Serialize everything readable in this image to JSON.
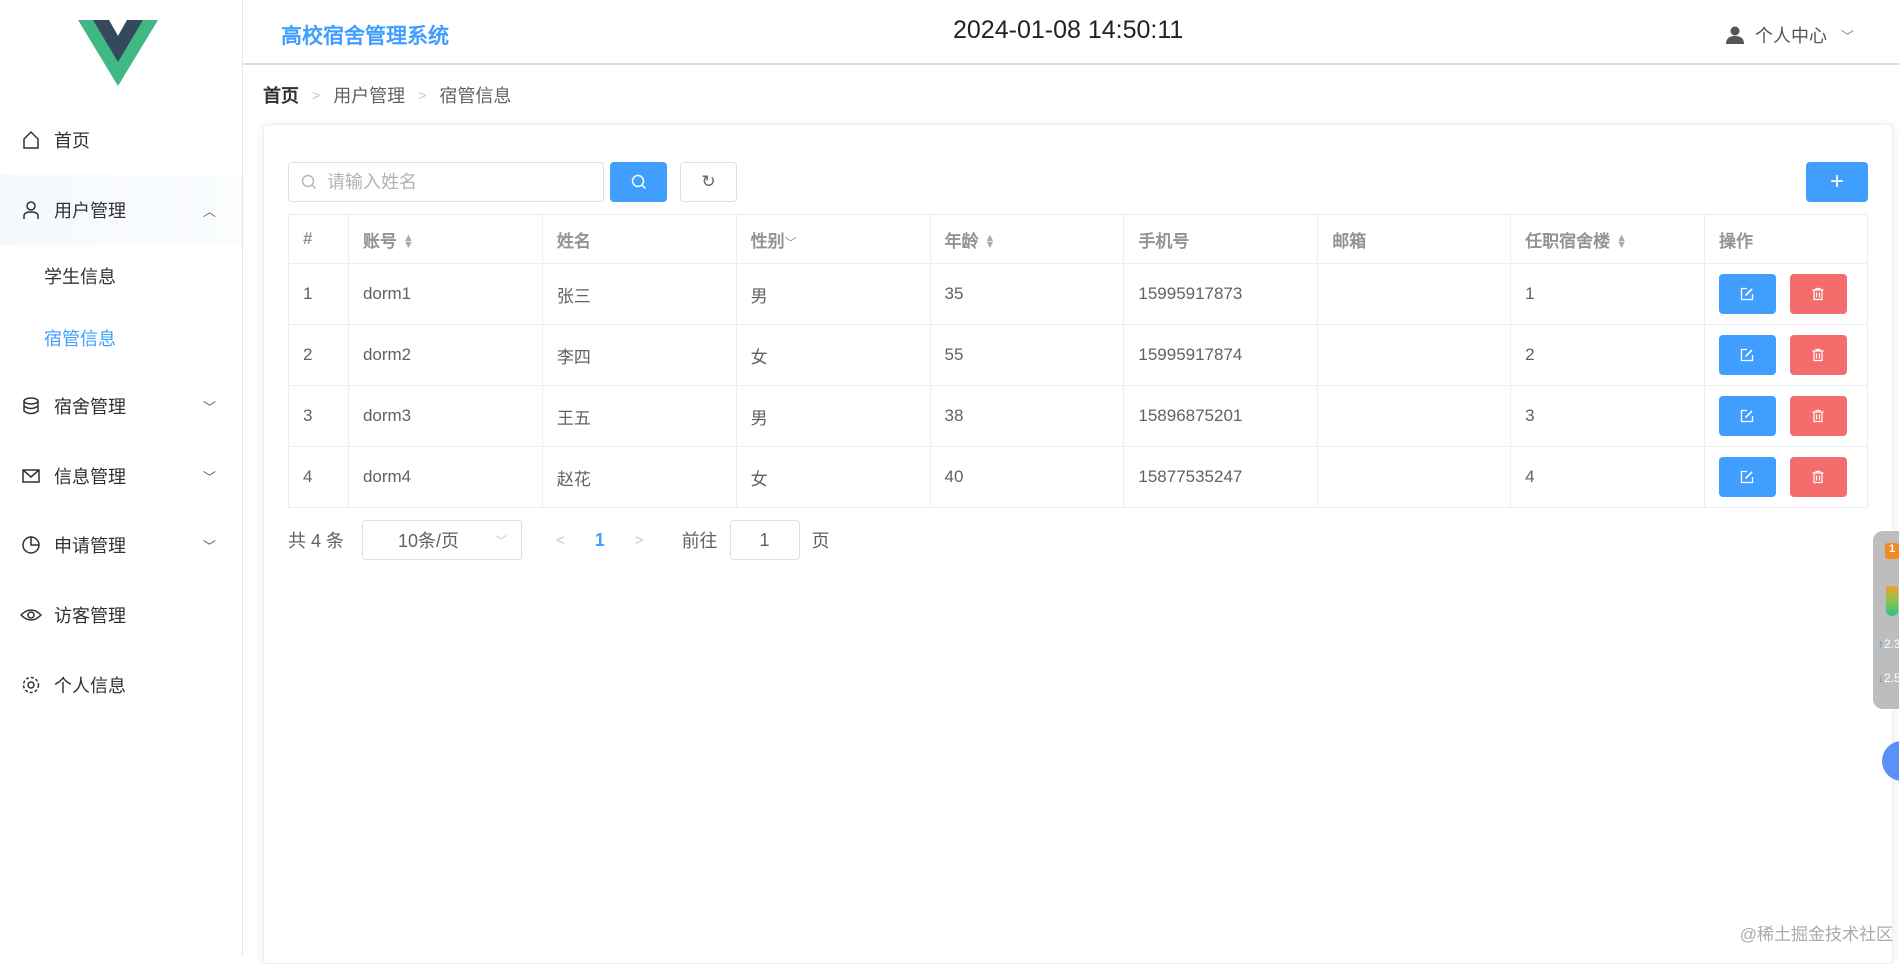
{
  "header": {
    "app_title": "高校宿舍管理系统",
    "datetime": "2024-01-08 14:50:11",
    "user_menu": "个人中心"
  },
  "sidebar": {
    "items": [
      {
        "label": "首页",
        "icon": "home-icon"
      },
      {
        "label": "用户管理",
        "icon": "user-icon",
        "expanded": true,
        "children": [
          {
            "label": "学生信息"
          },
          {
            "label": "宿管信息",
            "active": true
          }
        ]
      },
      {
        "label": "宿舍管理",
        "icon": "database-icon"
      },
      {
        "label": "信息管理",
        "icon": "message-icon"
      },
      {
        "label": "申请管理",
        "icon": "pie-chart-icon"
      },
      {
        "label": "访客管理",
        "icon": "eye-icon"
      },
      {
        "label": "个人信息",
        "icon": "gear-icon"
      }
    ]
  },
  "breadcrumb": [
    "首页",
    "用户管理",
    "宿管信息"
  ],
  "search": {
    "placeholder": "请输入姓名",
    "value": ""
  },
  "table": {
    "columns": [
      "#",
      "账号",
      "姓名",
      "性别",
      "年龄",
      "手机号",
      "邮箱",
      "任职宿舍楼",
      "操作"
    ],
    "rows": [
      {
        "index": "1",
        "account": "dorm1",
        "name": "张三",
        "gender": "男",
        "age": "35",
        "phone": "15995917873",
        "email": "",
        "building": "1"
      },
      {
        "index": "2",
        "account": "dorm2",
        "name": "李四",
        "gender": "女",
        "age": "55",
        "phone": "15995917874",
        "email": "",
        "building": "2"
      },
      {
        "index": "3",
        "account": "dorm3",
        "name": "王五",
        "gender": "男",
        "age": "38",
        "phone": "15896875201",
        "email": "",
        "building": "3"
      },
      {
        "index": "4",
        "account": "dorm4",
        "name": "赵花",
        "gender": "女",
        "age": "40",
        "phone": "15877535247",
        "email": "",
        "building": "4"
      }
    ]
  },
  "pagination": {
    "total": "共 4 条",
    "page_size": "10条/页",
    "current_page": "1",
    "goto_label": "前往",
    "goto_value": "1",
    "page_suffix": "页"
  },
  "widget": {
    "badge": "1",
    "up": "2.3",
    "down": "2.5"
  },
  "watermark": "@稀土掘金技术社区",
  "colors": {
    "primary": "#409eff",
    "danger": "#f56c6c",
    "logo_green": "#41b883",
    "logo_dark": "#35495e"
  }
}
